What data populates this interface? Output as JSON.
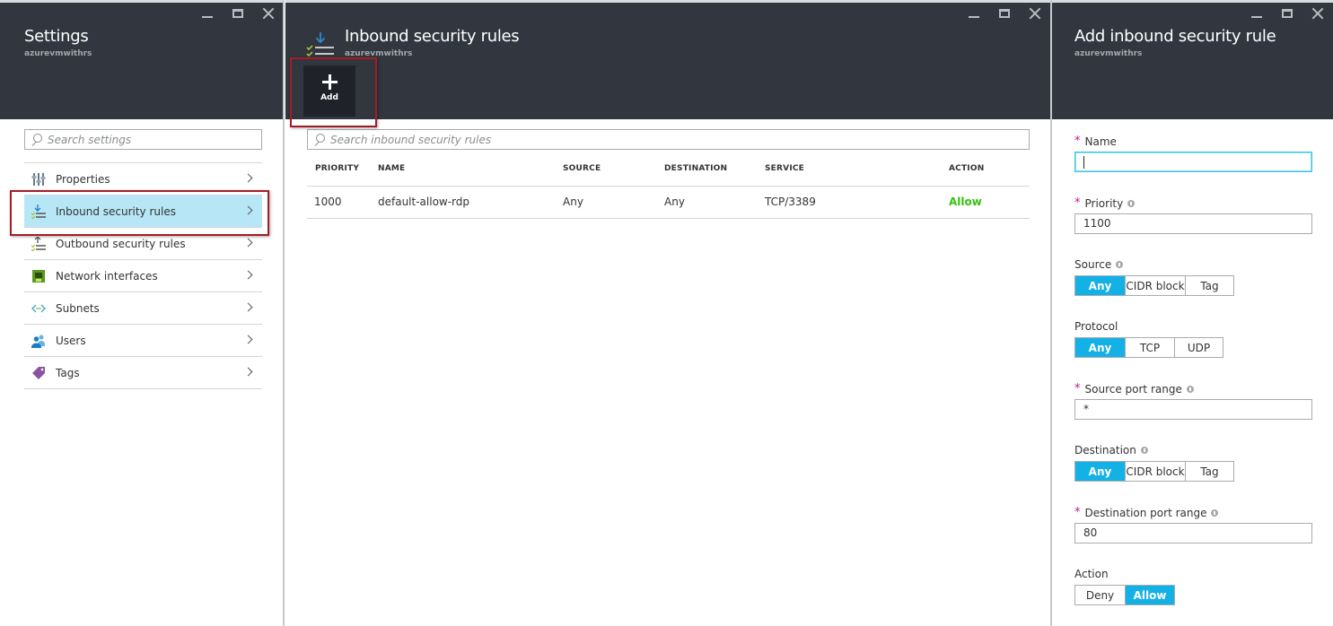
{
  "settings_blade": {
    "title": "Settings",
    "subtitle": "azurevmwithrs",
    "search_placeholder": "Search settings",
    "items": [
      {
        "label": "Properties",
        "icon": "properties-icon",
        "active": false
      },
      {
        "label": "Inbound security rules",
        "icon": "inbound-rules-icon",
        "active": true
      },
      {
        "label": "Outbound security rules",
        "icon": "outbound-rules-icon",
        "active": false
      },
      {
        "label": "Network interfaces",
        "icon": "network-interface-icon",
        "active": false
      },
      {
        "label": "Subnets",
        "icon": "subnet-icon",
        "active": false
      },
      {
        "label": "Users",
        "icon": "users-icon",
        "active": false
      },
      {
        "label": "Tags",
        "icon": "tag-icon",
        "active": false
      }
    ]
  },
  "inbound_blade": {
    "title": "Inbound security rules",
    "subtitle": "azurevmwithrs",
    "add_label": "Add",
    "search_placeholder": "Search inbound security rules",
    "columns": [
      "PRIORITY",
      "NAME",
      "SOURCE",
      "DESTINATION",
      "SERVICE",
      "ACTION"
    ],
    "rows": [
      {
        "priority": "1000",
        "name": "default-allow-rdp",
        "source": "Any",
        "destination": "Any",
        "service": "TCP/3389",
        "action": "Allow"
      }
    ]
  },
  "add_rule_blade": {
    "title": "Add inbound security rule",
    "subtitle": "azurevmwithrs",
    "name_label": "Name",
    "name_value": "",
    "priority_label": "Priority",
    "priority_value": "1100",
    "source_label": "Source",
    "source_options": [
      "Any",
      "CIDR block",
      "Tag"
    ],
    "source_selected": "Any",
    "protocol_label": "Protocol",
    "protocol_options": [
      "Any",
      "TCP",
      "UDP"
    ],
    "protocol_selected": "Any",
    "source_port_label": "Source port range",
    "source_port_value": "*",
    "destination_label": "Destination",
    "destination_options": [
      "Any",
      "CIDR block",
      "Tag"
    ],
    "destination_selected": "Any",
    "destination_port_label": "Destination port range",
    "destination_port_value": "80",
    "action_label": "Action",
    "action_options": [
      "Deny",
      "Allow"
    ],
    "action_selected": "Allow"
  },
  "colors": {
    "header_bg": "#32373f",
    "accent": "#14b1e7",
    "active_item_bg": "#b7e6f6",
    "allow_green": "#34c20c",
    "required_star": "#c1168e",
    "highlight_box": "#a51d24"
  }
}
